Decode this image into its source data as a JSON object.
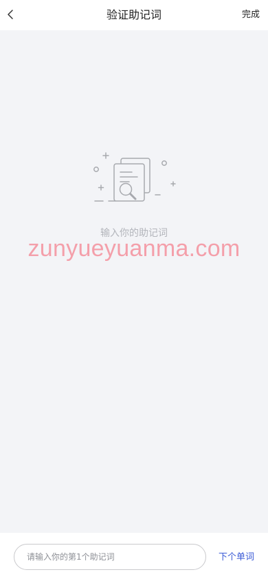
{
  "header": {
    "title": "验证助记词",
    "done_label": "完成"
  },
  "empty_state": {
    "message": "输入你的助记词",
    "icon": "document-search-icon"
  },
  "watermark": {
    "text": "zunyueyuanma.com"
  },
  "input_bar": {
    "placeholder": "请输入你的第1个助记词",
    "value": "",
    "next_label": "下个单词"
  },
  "colors": {
    "background": "#f3f4f7",
    "accent": "#3b5bd6",
    "watermark": "#f47a89"
  }
}
